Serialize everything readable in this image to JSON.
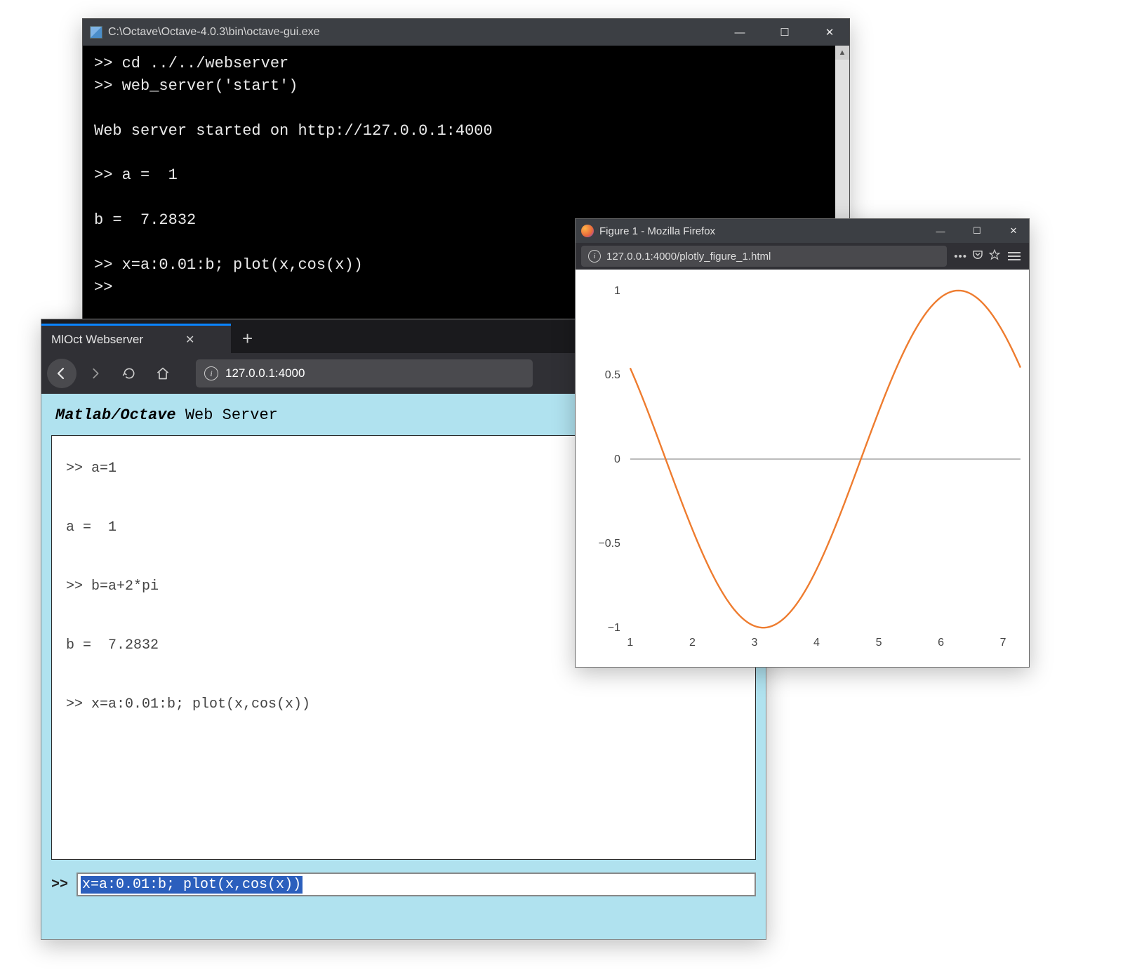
{
  "terminal": {
    "title": "C:\\Octave\\Octave-4.0.3\\bin\\octave-gui.exe",
    "lines": ">> cd ../../webserver\n>> web_server('start')\n\nWeb server started on http://127.0.0.1:4000\n\n>> a =  1\n\nb =  7.2832\n\n>> x=a:0.01:b; plot(x,cos(x))\n>>"
  },
  "web_browser": {
    "tab_title": "MlOct Webserver",
    "url_display": "127.0.0.1:4000",
    "page_heading_bold": "Matlab/Octave",
    "page_heading_rest": " Web Server",
    "console_text": ">> a=1\n\na =  1\n\n>> b=a+2*pi\n\nb =  7.2832\n\n>> x=a:0.01:b; plot(x,cos(x))",
    "prompt": ">>",
    "input_value": "x=a:0.01:b; plot(x,cos(x))"
  },
  "figure_browser": {
    "title": "Figure 1 - Mozilla Firefox",
    "url_display": "127.0.0.1:4000/plotly_figure_1.html",
    "url_ellipsis": "•••"
  },
  "chart_data": {
    "type": "line",
    "title": "",
    "xlabel": "",
    "ylabel": "",
    "xlim": [
      1,
      7.28
    ],
    "ylim": [
      -1,
      1
    ],
    "xticks": [
      1,
      2,
      3,
      4,
      5,
      6,
      7
    ],
    "yticks": [
      -1,
      -0.5,
      0,
      0.5,
      1
    ],
    "ytick_labels": [
      "−1",
      "−0.5",
      "0",
      "0.5",
      "1"
    ],
    "series": [
      {
        "name": "cos(x)",
        "color": "#ee7c2f",
        "formula": "cos(x)",
        "x_start": 1,
        "x_end": 7.2832,
        "x_step": 0.01
      }
    ]
  }
}
